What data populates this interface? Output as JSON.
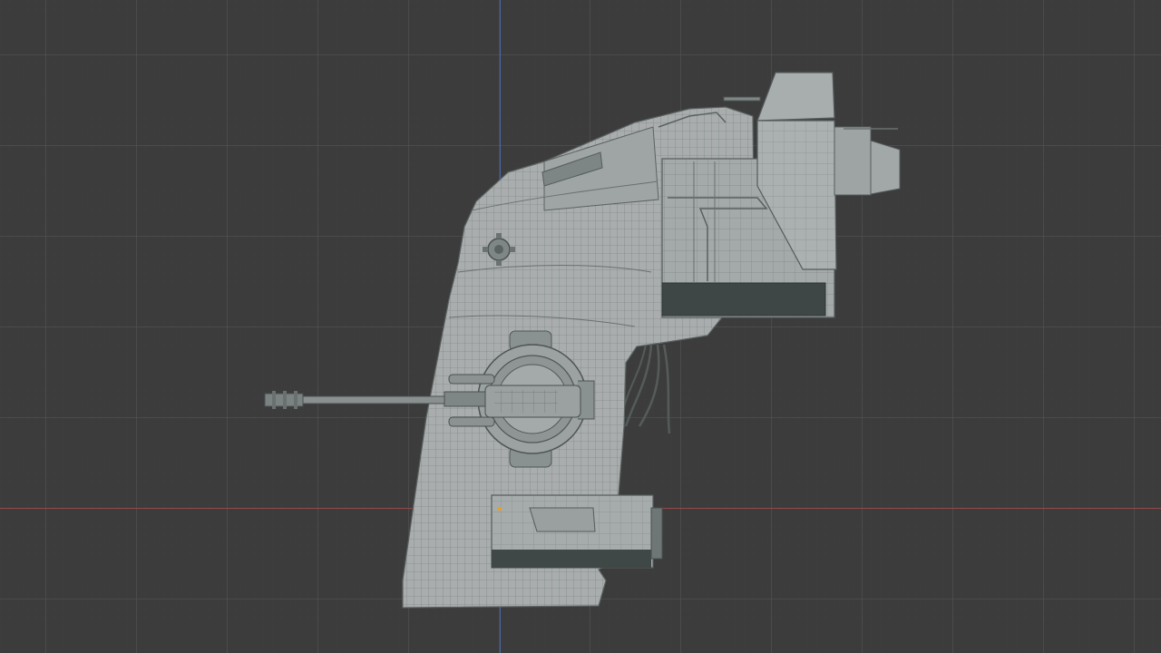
{
  "viewport": {
    "mode": "orthographic-side-view",
    "shading": "solid-wireframe",
    "background_color": "#3c3c3c",
    "grid_color": "#555555",
    "x_axis_color": "#a34848",
    "y_axis_color": "#4d6fb8",
    "model_surface_color": "#a9adad",
    "model_wire_color": "#5b6262",
    "dark_panel_color": "#3a4242",
    "selection_dot_color": "#e8a020"
  },
  "model": {
    "name_icon": "mech-walker-mesh",
    "parts": [
      "body",
      "top-pod",
      "head-block",
      "side-cannon",
      "turret-ring",
      "lower-pod",
      "cable-bundle"
    ]
  }
}
